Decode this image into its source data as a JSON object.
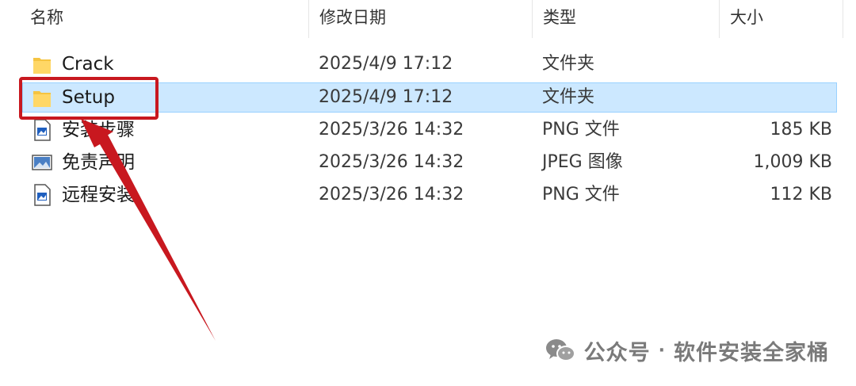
{
  "header": {
    "col_name": "名称",
    "col_date": "修改日期",
    "col_type": "类型",
    "col_size": "大小"
  },
  "files": [
    {
      "name": "Crack",
      "date": "2025/4/9 17:12",
      "type": "文件夹",
      "size": "",
      "icon": "folder-icon"
    },
    {
      "name": "Setup",
      "date": "2025/4/9 17:12",
      "type": "文件夹",
      "size": "",
      "icon": "folder-icon",
      "selected": true
    },
    {
      "name": "安装步骤",
      "date": "2025/3/26 14:32",
      "type": "PNG 文件",
      "size": "185 KB",
      "icon": "png-file-icon"
    },
    {
      "name": "免责声明",
      "date": "2025/3/26 14:32",
      "type": "JPEG 图像",
      "size": "1,009 KB",
      "icon": "jpeg-image-icon"
    },
    {
      "name": "远程安装",
      "date": "2025/3/26 14:32",
      "type": "PNG 文件",
      "size": "112 KB",
      "icon": "png-file-icon"
    }
  ],
  "watermark": {
    "account_label": "公众号",
    "separator": "·",
    "account_name": "软件安装全家桶"
  },
  "colors": {
    "selection_bg": "#cce8ff",
    "selection_border": "#99d1ff",
    "annotation_red": "#c8181f",
    "folder_yellow": "#ffd766"
  }
}
